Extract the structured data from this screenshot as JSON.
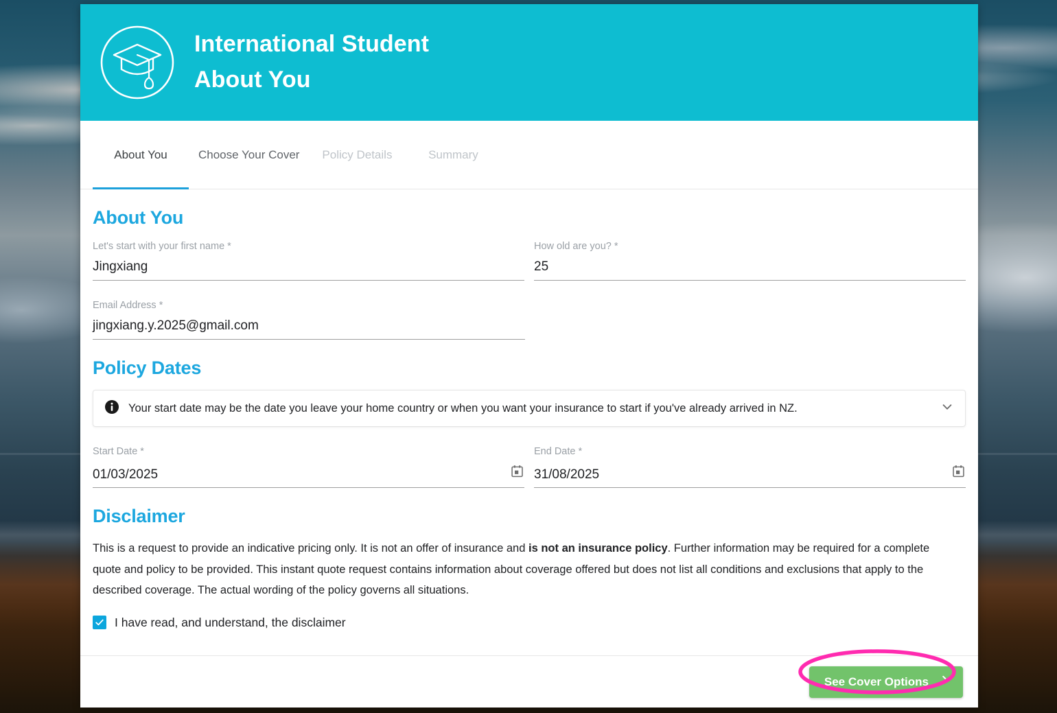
{
  "header": {
    "logo_icon": "graduation-cap-icon",
    "title_line1": "International Student",
    "title_line2": "About You",
    "brand_color": "#0ebdd1"
  },
  "tabs": [
    {
      "label": "About You",
      "state": "active"
    },
    {
      "label": "Choose Your Cover",
      "state": "enabled"
    },
    {
      "label": "Policy Details",
      "state": "disabled"
    },
    {
      "label": "Summary",
      "state": "disabled"
    }
  ],
  "about_you": {
    "section_title": "About You",
    "first_name": {
      "label": "Let's start with your first name *",
      "value": "Jingxiang"
    },
    "age": {
      "label": "How old are you? *",
      "value": "25"
    },
    "email": {
      "label": "Email Address *",
      "value": "jingxiang.y.2025@gmail.com"
    }
  },
  "policy_dates": {
    "section_title": "Policy Dates",
    "info_icon": "info-circle-icon",
    "info_text": "Your start date may be the date you leave your home country or when you want your insurance to start if you've already arrived in NZ.",
    "expand_icon": "chevron-down-icon",
    "start_date": {
      "label": "Start Date *",
      "value": "01/03/2025",
      "icon": "calendar-icon"
    },
    "end_date": {
      "label": "End Date *",
      "value": "31/08/2025",
      "icon": "calendar-icon"
    }
  },
  "disclaimer": {
    "section_title": "Disclaimer",
    "text_part1": "This is a request to provide an indicative pricing only. It is not an offer of insurance and ",
    "text_bold": "is not an insurance policy",
    "text_part2": ". Further information may be required for a complete quote and policy to be provided. This instant quote request contains information about coverage offered but does not list all conditions and exclusions that apply to the described coverage. The actual wording of the policy governs all situations.",
    "checkbox_label": "I have read, and understand, the disclaimer",
    "checkbox_checked": true,
    "checkbox_color": "#0ca6dd"
  },
  "footer": {
    "cta_label": "See Cover Options",
    "cta_icon": "chevron-right-icon",
    "cta_color": "#72c36b",
    "annotation_color": "#ff2bb0"
  }
}
